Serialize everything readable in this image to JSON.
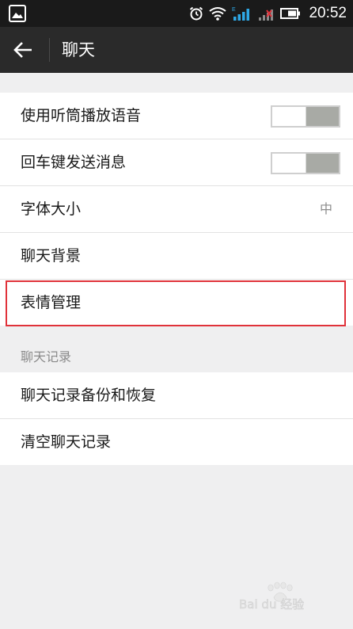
{
  "status_bar": {
    "time": "20:52",
    "network_label": "E"
  },
  "header": {
    "title": "聊天"
  },
  "settings": {
    "items": [
      {
        "label": "使用听筒播放语音",
        "type": "toggle",
        "on": false
      },
      {
        "label": "回车键发送消息",
        "type": "toggle",
        "on": false
      },
      {
        "label": "字体大小",
        "type": "value",
        "value": "中"
      },
      {
        "label": "聊天背景",
        "type": "link"
      },
      {
        "label": "表情管理",
        "type": "link",
        "highlighted": true
      }
    ]
  },
  "chat_history": {
    "section_title": "聊天记录",
    "items": [
      {
        "label": "聊天记录备份和恢复"
      },
      {
        "label": "清空聊天记录"
      }
    ]
  },
  "watermark": {
    "text": "Bai du 经验"
  },
  "colors": {
    "status_bar_bg": "#1a1a1a",
    "action_bar_bg": "#2a2a2a",
    "page_bg": "#efeff0",
    "highlight_border": "#e0323a",
    "toggle_off": "#a8aaa5",
    "signal_blue": "#2ea8e6"
  }
}
